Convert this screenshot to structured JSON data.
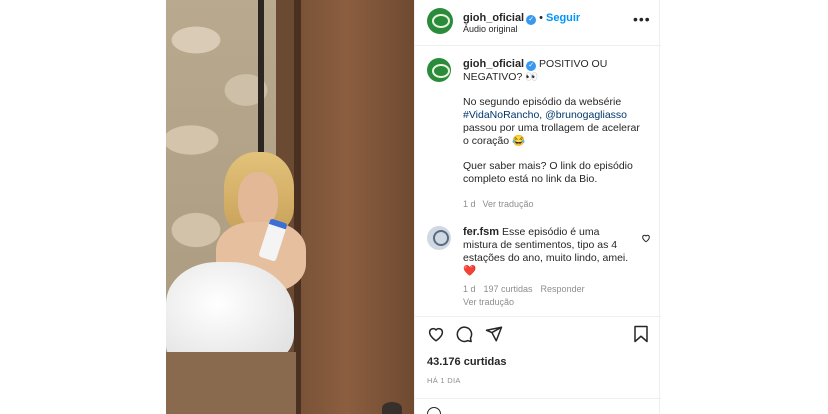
{
  "post": {
    "username": "gioh_oficial",
    "follow_label": "Seguir",
    "audio_label": "Áudio original",
    "more_label": "•••"
  },
  "caption": {
    "username": "gioh_oficial",
    "line1": "POSITIVO OU NEGATIVO? 👀",
    "p2_part1": "No segundo episódio da websérie ",
    "hashtag": "#VidaNoRancho",
    "comma": ", ",
    "mention": "@brunogagliasso",
    "p2_part2": " passou por uma trollagem de acelerar o coração 😂",
    "p3": "Quer saber mais? O link do episódio completo está no link da Bio.",
    "age": "1 d",
    "translate": "Ver tradução"
  },
  "comment": {
    "username": "fer.fsm",
    "text": "Esse episódio é uma mistura de sentimentos, tipo as 4 estações do ano, muito lindo, amei.❤️",
    "age": "1 d",
    "likes": "197 curtidas",
    "reply": "Responder",
    "translate": "Ver tradução"
  },
  "footer": {
    "likes": "43.176 curtidas",
    "time": "HÁ 1 DIA"
  },
  "icons": {
    "like": "heart-icon",
    "comment": "comment-icon",
    "share": "send-icon",
    "save": "bookmark-icon"
  }
}
